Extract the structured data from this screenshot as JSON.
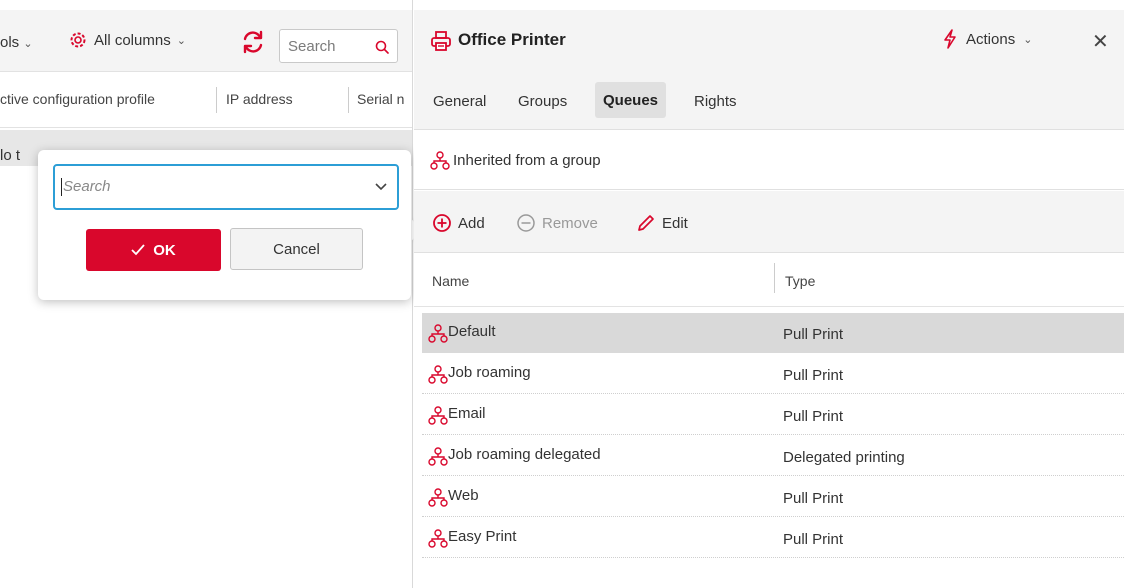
{
  "left_toolbar": {
    "tools_label": "ols",
    "columns_label": "All columns",
    "search_placeholder": "Search"
  },
  "left_columns": {
    "col1": "ctive configuration profile",
    "col2": "IP address",
    "col3": "Serial n"
  },
  "left_row": {
    "text": "lo t"
  },
  "popup": {
    "search_placeholder": "Search",
    "ok_label": "OK",
    "cancel_label": "Cancel"
  },
  "detail": {
    "title": "Office Printer",
    "actions_label": "Actions",
    "close_label": "✕",
    "tabs": [
      {
        "label": "General",
        "active": false
      },
      {
        "label": "Groups",
        "active": false
      },
      {
        "label": "Queues",
        "active": true
      },
      {
        "label": "Rights",
        "active": false
      }
    ],
    "inherited_label": "Inherited from a group",
    "add_label": "Add",
    "remove_label": "Remove",
    "edit_label": "Edit",
    "table_headers": {
      "name": "Name",
      "type": "Type"
    },
    "rows": [
      {
        "name": "Default",
        "type": "Pull Print",
        "selected": true
      },
      {
        "name": "Job roaming",
        "type": "Pull Print",
        "selected": false
      },
      {
        "name": "Email",
        "type": "Pull Print",
        "selected": false
      },
      {
        "name": "Job roaming delegated",
        "type": "Delegated printing",
        "selected": false
      },
      {
        "name": "Web",
        "type": "Pull Print",
        "selected": false
      },
      {
        "name": "Easy Print",
        "type": "Pull Print",
        "selected": false
      }
    ]
  },
  "colors": {
    "accent_red": "#d9072c",
    "focus_blue": "#2c9ed6",
    "toolbar_bg": "#f4f4f4",
    "selected_row": "#d9d9d9"
  }
}
